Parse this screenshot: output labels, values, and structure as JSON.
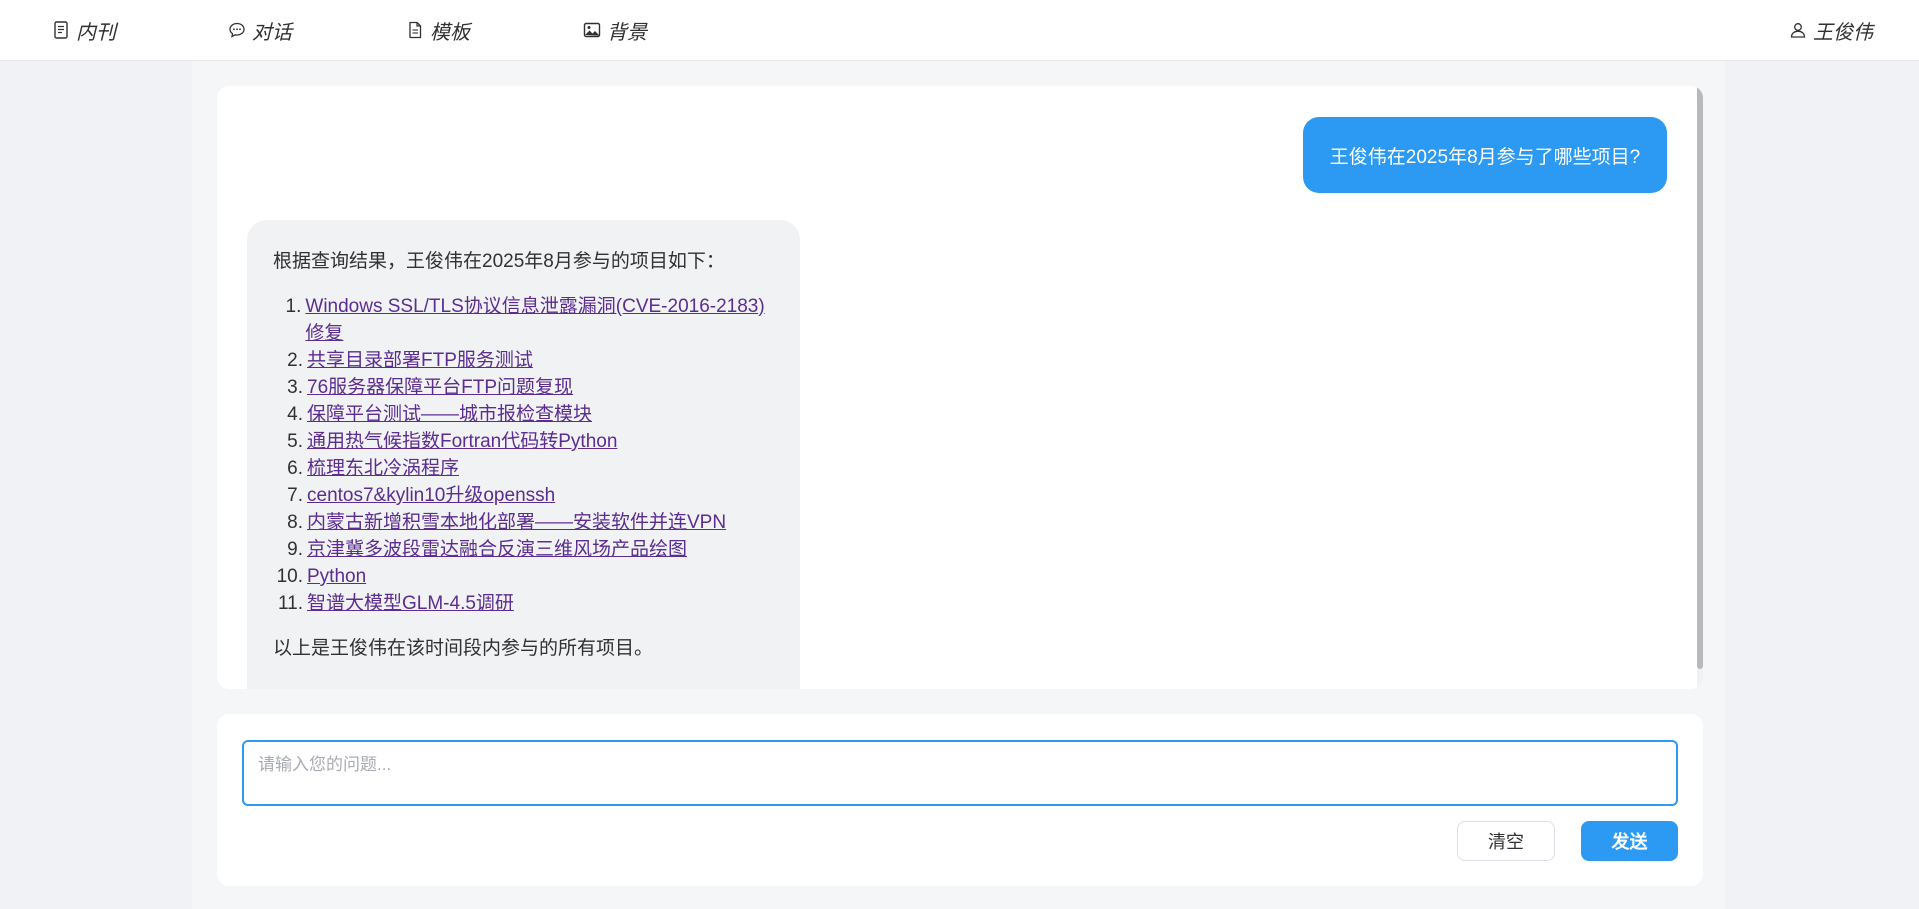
{
  "nav": {
    "items": [
      {
        "label": "内刊",
        "icon": "document-icon"
      },
      {
        "label": "对话",
        "icon": "chat-bubble-icon"
      },
      {
        "label": "模板",
        "icon": "file-icon"
      },
      {
        "label": "背景",
        "icon": "image-icon"
      }
    ],
    "user": {
      "label": "王俊伟",
      "icon": "user-icon"
    }
  },
  "chat": {
    "user_message": "王俊伟在2025年8月参与了哪些项目?",
    "assistant": {
      "intro": "根据查询结果，王俊伟在2025年8月参与的项目如下：",
      "projects": [
        {
          "num": "1.",
          "title": "Windows SSL/TLS协议信息泄露漏洞(CVE-2016-2183)修复"
        },
        {
          "num": "2.",
          "title": "共享目录部署FTP服务测试"
        },
        {
          "num": "3.",
          "title": "76服务器保障平台FTP问题复现"
        },
        {
          "num": "4.",
          "title": "保障平台测试——城市报检查模块"
        },
        {
          "num": "5.",
          "title": "通用热气候指数Fortran代码转Python"
        },
        {
          "num": "6.",
          "title": "梳理东北冷涡程序"
        },
        {
          "num": "7.",
          "title": "centos7&kylin10升级openssh"
        },
        {
          "num": "8.",
          "title": "内蒙古新增积雪本地化部署——安装软件并连VPN"
        },
        {
          "num": "9.",
          "title": "京津冀多波段雷达融合反演三维风场产品绘图"
        },
        {
          "num": "10.",
          "title": "Python"
        },
        {
          "num": "11.",
          "title": "智谱大模型GLM-4.5调研"
        }
      ],
      "outro": "以上是王俊伟在该时间段内参与的所有项目。"
    }
  },
  "composer": {
    "placeholder": "请输入您的问题...",
    "value": "",
    "clear_label": "清空",
    "send_label": "发送"
  },
  "colors": {
    "accent": "#2c9af3",
    "link": "#5b2d91",
    "assistant_bubble": "#f1f2f4"
  }
}
